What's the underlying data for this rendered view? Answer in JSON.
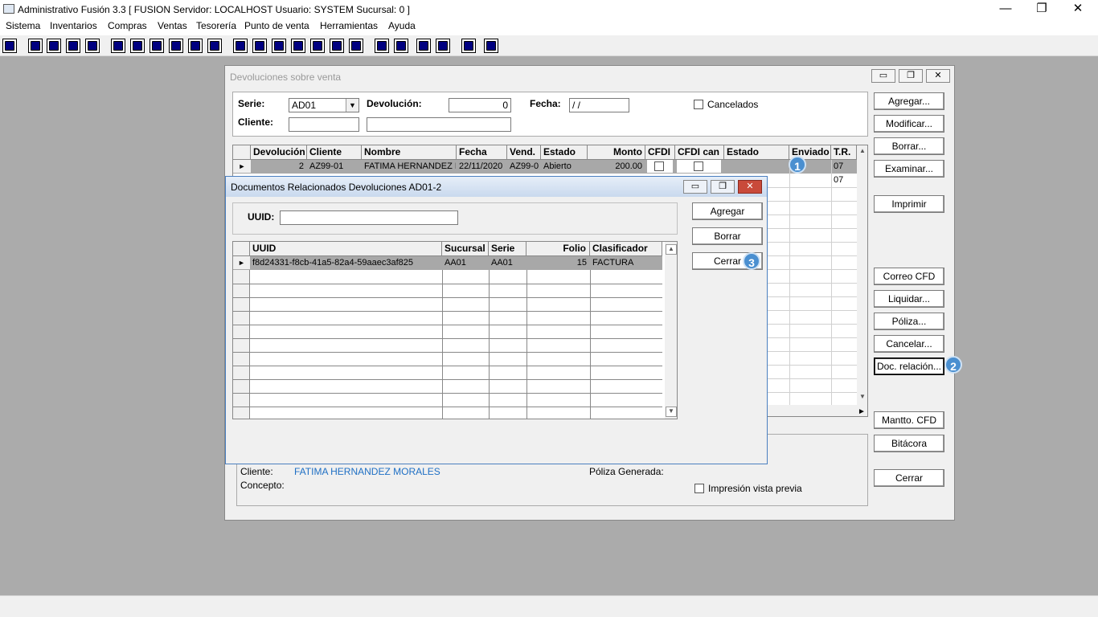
{
  "app": {
    "title": "Administrativo Fusión 3.3 [ FUSION  Servidor: LOCALHOST   Usuario: SYSTEM    Sucursal: 0 ]",
    "minimize": "—",
    "restore": "❐",
    "close": "✕"
  },
  "menu": [
    "Sistema",
    "Inventarios",
    "Compras",
    "Ventas",
    "Tesorería",
    "Punto de venta",
    "Herramientas",
    "Ayuda"
  ],
  "devoluciones": {
    "title": "Devoluciones sobre venta",
    "serie_label": "Serie:",
    "serie_value": "AD01",
    "devolucion_label": "Devolución:",
    "devolucion_value": "0",
    "fecha_label": "Fecha:",
    "fecha_value": " / /",
    "cancelados_label": "Cancelados",
    "cliente_label": "Cliente:",
    "grid_headers": [
      "Devolución",
      "Cliente",
      "Nombre",
      "Fecha",
      "Vend.",
      "Estado",
      "Monto",
      "CFDI",
      "CFDI can",
      "Estado",
      "Enviado",
      "T.R."
    ],
    "row": {
      "devolucion": "2",
      "cliente": "AZ99-01",
      "nombre": "FATIMA HERNANDEZ M",
      "fecha": "22/11/2020",
      "vend": "AZ99-0",
      "estado": "Abierto",
      "monto": "200.00",
      "tr": "07"
    },
    "row2_tr": "07",
    "buttons": {
      "agregar": "Agregar...",
      "modificar": "Modificar...",
      "borrar": "Borrar...",
      "examinar": "Examinar...",
      "imprimir": "Imprimir",
      "correo": "Correo CFD",
      "liquidar": "Liquidar...",
      "poliza": "Póliza...",
      "cancelar": "Cancelar...",
      "docrel": "Doc. relación...",
      "mantto": "Mantto. CFD",
      "bitacora": "Bitácora",
      "cerrar": "Cerrar"
    },
    "footer": {
      "cliente_label": "Cliente:",
      "cliente_value": "FATIMA HERNANDEZ MORALES",
      "concepto_label": "Concepto:",
      "poliza_label": "Póliza Generada:",
      "impresion_label": "Impresión vista previa"
    }
  },
  "docrel": {
    "title": "Documentos Relacionados Devoluciones AD01-2",
    "uuid_label": "UUID:",
    "uuid_value": "",
    "headers": [
      "UUID",
      "Sucursal",
      "Serie",
      "Folio",
      "Clasificador"
    ],
    "row": {
      "uuid": "f8d24331-f8cb-41a5-82a4-59aaec3af825",
      "sucursal": "AA01",
      "serie": "AA01",
      "folio": "15",
      "clasificador": "FACTURA"
    },
    "buttons": {
      "agregar": "Agregar",
      "borrar": "Borrar",
      "cerrar": "Cerrar"
    }
  },
  "badges": [
    "1",
    "2",
    "3"
  ]
}
